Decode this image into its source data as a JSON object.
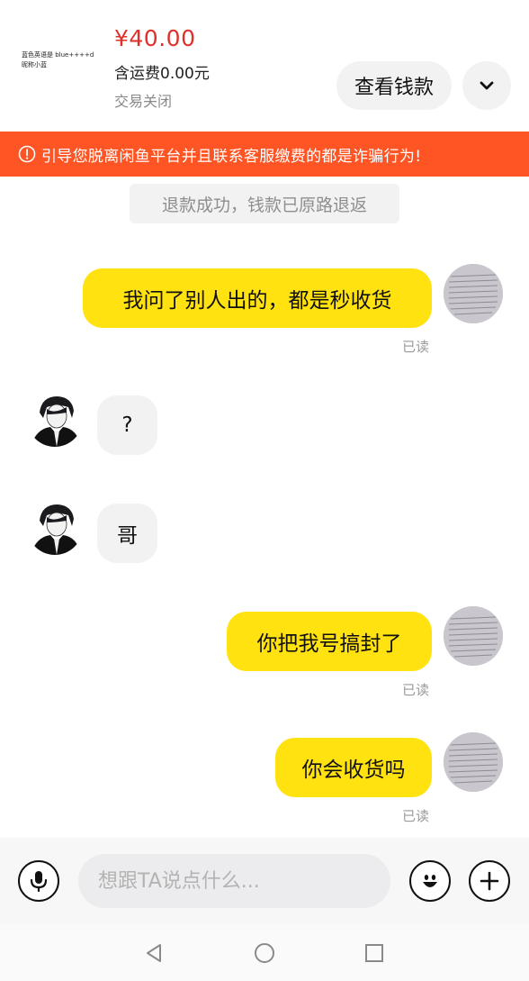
{
  "product": {
    "thumbnail_lines": [
      "蓝色英语是 blue++++d",
      "昵称小蓝"
    ],
    "price": "¥40.00",
    "shipping": "含运费0.00元",
    "status": "交易关闭",
    "view_money_label": "查看钱款",
    "more_icon": "chevron-down-icon"
  },
  "warning": {
    "text": "引导您脱离闲鱼平台并且联系客服缴费的都是诈骗行为!",
    "icon": "exclamation-circle-icon",
    "color": "#ff5524"
  },
  "system_notice": "退款成功，钱款已原路退返",
  "messages": [
    {
      "sender": "me",
      "text": "我问了别人出的，都是秒收货",
      "read": "已读"
    },
    {
      "sender": "them",
      "text": "?"
    },
    {
      "sender": "them",
      "text": "哥"
    },
    {
      "sender": "me",
      "text": "你把我号搞封了",
      "read": "已读"
    },
    {
      "sender": "me",
      "text": "你会收货吗",
      "read": "已读"
    }
  ],
  "input": {
    "placeholder": "想跟TA说点什么...",
    "voice_icon": "microphone-icon",
    "emoji_icon": "smiley-icon",
    "add_icon": "plus-icon"
  },
  "nav": {
    "back_icon": "back-triangle-icon",
    "home_icon": "home-circle-icon",
    "recents_icon": "recents-square-icon"
  },
  "colors": {
    "my_bubble": "#ffe20f",
    "their_bubble": "#f2f2f3",
    "price": "#e0302a"
  }
}
